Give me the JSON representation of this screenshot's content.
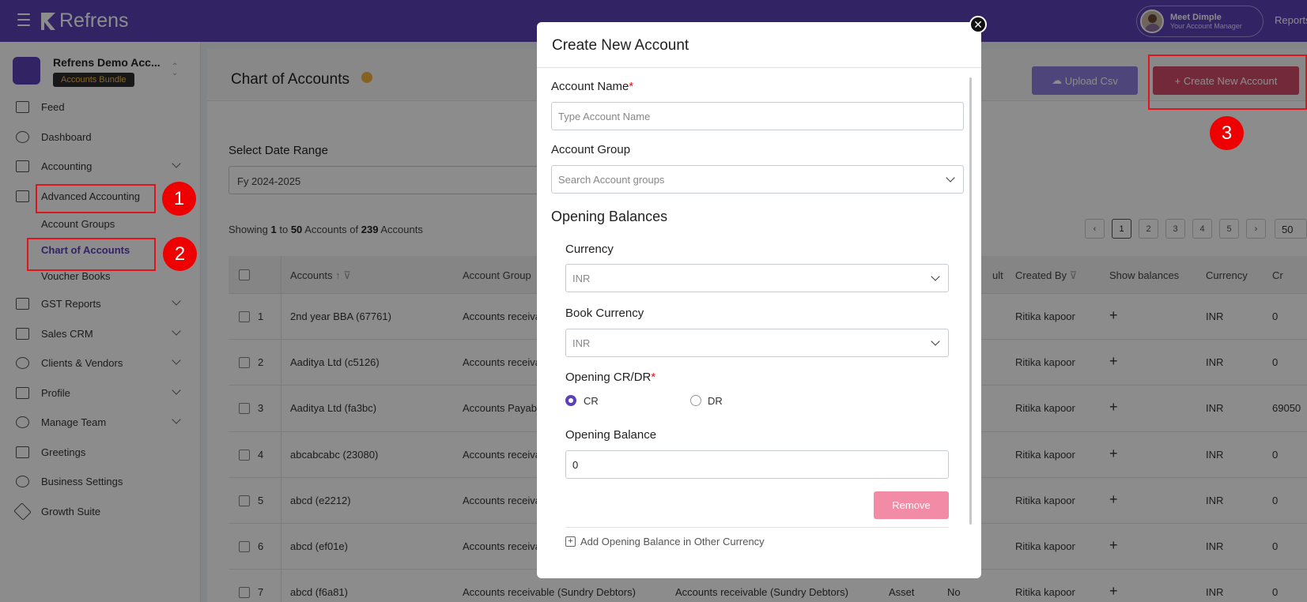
{
  "topbar": {
    "logo": "Refrens",
    "manager_name": "Meet Dimple",
    "manager_role": "Your Account Manager",
    "reports": "Reports"
  },
  "sidebar": {
    "org_name": "Refrens Demo Acc...",
    "org_badge": "Accounts Bundle",
    "items": [
      {
        "label": "Feed",
        "icon": "feed-icon"
      },
      {
        "label": "Dashboard",
        "icon": "dashboard-icon"
      },
      {
        "label": "Accounting",
        "icon": "accounting-icon"
      },
      {
        "label": "Advanced Accounting",
        "icon": "advanced-accounting-icon"
      },
      {
        "label": "GST Reports",
        "icon": "gst-icon"
      },
      {
        "label": "Sales CRM",
        "icon": "crm-icon"
      },
      {
        "label": "Clients & Vendors",
        "icon": "clients-icon"
      },
      {
        "label": "Profile",
        "icon": "profile-icon"
      },
      {
        "label": "Manage Team",
        "icon": "team-icon"
      },
      {
        "label": "Greetings",
        "icon": "greetings-icon"
      },
      {
        "label": "Business Settings",
        "icon": "settings-icon"
      },
      {
        "label": "Growth Suite",
        "icon": "rocket-icon"
      }
    ],
    "sub_items": [
      {
        "label": "Account Groups"
      },
      {
        "label": "Chart of Accounts"
      },
      {
        "label": "Voucher Books"
      }
    ]
  },
  "annotations": {
    "b1": "1",
    "b2": "2",
    "b3": "3"
  },
  "page": {
    "title": "Chart of Accounts",
    "upload_csv": "Upload Csv",
    "create_account": "+ Create New Account",
    "date_range_label": "Select Date Range",
    "date_range_value": "Fy 2024-2025",
    "showing": {
      "pre": "Showing",
      "from": "1",
      "to_word": "to",
      "to": "50",
      "mid": "Accounts of",
      "total": "239",
      "post": "Accounts"
    },
    "pages": [
      "1",
      "2",
      "3",
      "4",
      "5"
    ],
    "page_size": "50"
  },
  "table": {
    "headers": {
      "accounts": "Accounts",
      "account_group": "Account Group",
      "default": "ult",
      "created_by": "Created By",
      "show_balances": "Show balances",
      "currency": "Currency",
      "cr": "Cr"
    },
    "rows": [
      {
        "n": "1",
        "account": "2nd year BBA (67761)",
        "group": "Accounts receiva",
        "created_by": "Ritika kapoor",
        "currency": "INR",
        "cr": "0"
      },
      {
        "n": "2",
        "account": "Aaditya Ltd (c5126)",
        "group": "Accounts receiva",
        "created_by": "Ritika kapoor",
        "currency": "INR",
        "cr": "0"
      },
      {
        "n": "3",
        "account": "Aaditya Ltd (fa3bc)",
        "group": "Accounts Payab",
        "created_by": "Ritika kapoor",
        "currency": "INR",
        "cr": "69050"
      },
      {
        "n": "4",
        "account": "abcabcabc (23080)",
        "group": "Accounts receiva",
        "created_by": "Ritika kapoor",
        "currency": "INR",
        "cr": "0"
      },
      {
        "n": "5",
        "account": "abcd (e2212)",
        "group": "Accounts receiva",
        "created_by": "Ritika kapoor",
        "currency": "INR",
        "cr": "0"
      },
      {
        "n": "6",
        "account": "abcd (ef01e)",
        "group": "Accounts receiva",
        "created_by": "Ritika kapoor",
        "currency": "INR",
        "cr": "0"
      },
      {
        "n": "7",
        "account": "abcd (f6a81)",
        "group": "Accounts receivable (Sundry Debtors)",
        "parent": "Accounts receivable (Sundry Debtors)",
        "type": "Asset",
        "default": "No",
        "created_by": "Ritika kapoor",
        "currency": "INR",
        "cr": "0"
      }
    ]
  },
  "modal": {
    "title": "Create New Account",
    "account_name_label": "Account Name",
    "account_name_placeholder": "Type Account Name",
    "account_group_label": "Account Group",
    "account_group_placeholder": "Search Account groups",
    "opening_balances": "Opening Balances",
    "currency_label": "Currency",
    "currency_value": "INR",
    "book_currency_label": "Book Currency",
    "book_currency_value": "INR",
    "crdr_label": "Opening CR/DR",
    "cr": "CR",
    "dr": "DR",
    "opening_balance_label": "Opening Balance",
    "opening_balance_value": "0",
    "remove": "Remove",
    "add_other": "Add Opening Balance in Other Currency"
  }
}
